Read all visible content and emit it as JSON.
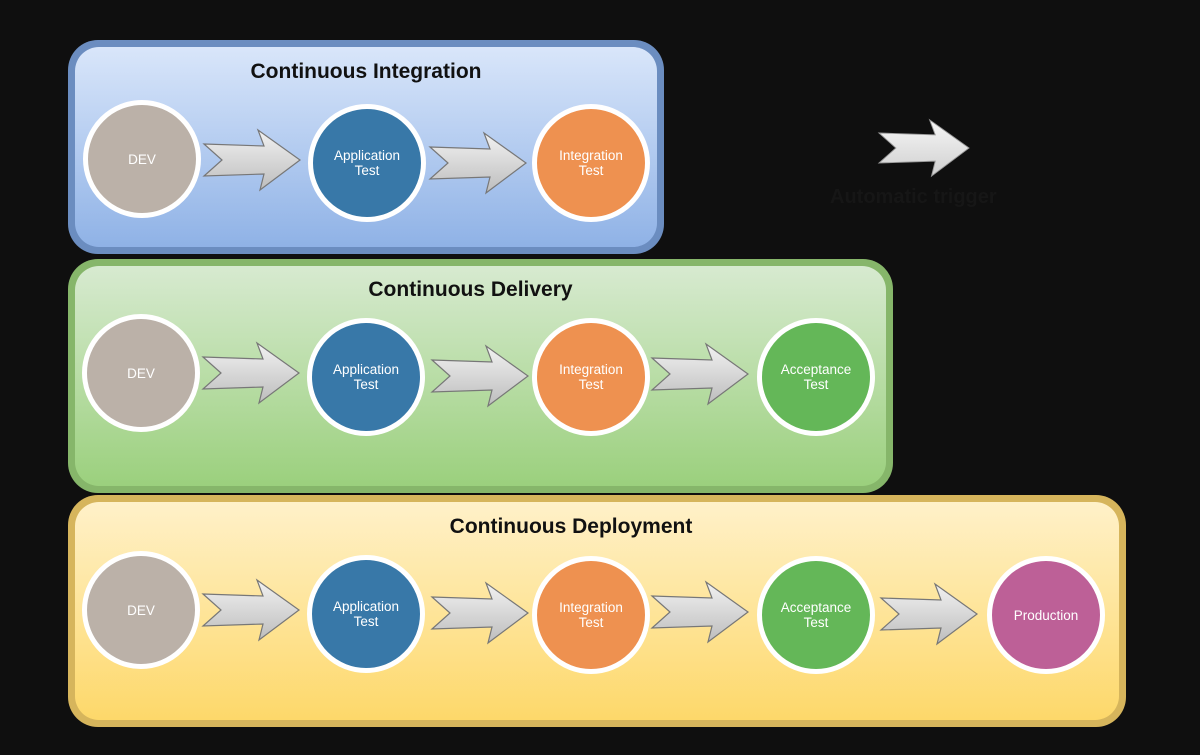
{
  "legend": {
    "icon": "right-arrow-icon",
    "label": "Automatic trigger"
  },
  "colors": {
    "dev": "#bbb1a8",
    "app": "#3878a8",
    "integ": "#ee9150",
    "accept": "#64b758",
    "prod": "#bd6097"
  },
  "panels": [
    {
      "title": "Continuous Integration",
      "nodes": [
        "DEV",
        "Application\nTest",
        "Integration\nTest"
      ]
    },
    {
      "title": "Continuous Delivery",
      "nodes": [
        "DEV",
        "Application\nTest",
        "Integration\nTest",
        "Acceptance\nTest"
      ]
    },
    {
      "title": "Continuous Deployment",
      "nodes": [
        "DEV",
        "Application\nTest",
        "Integration\nTest",
        "Acceptance\nTest",
        "Production"
      ]
    }
  ]
}
